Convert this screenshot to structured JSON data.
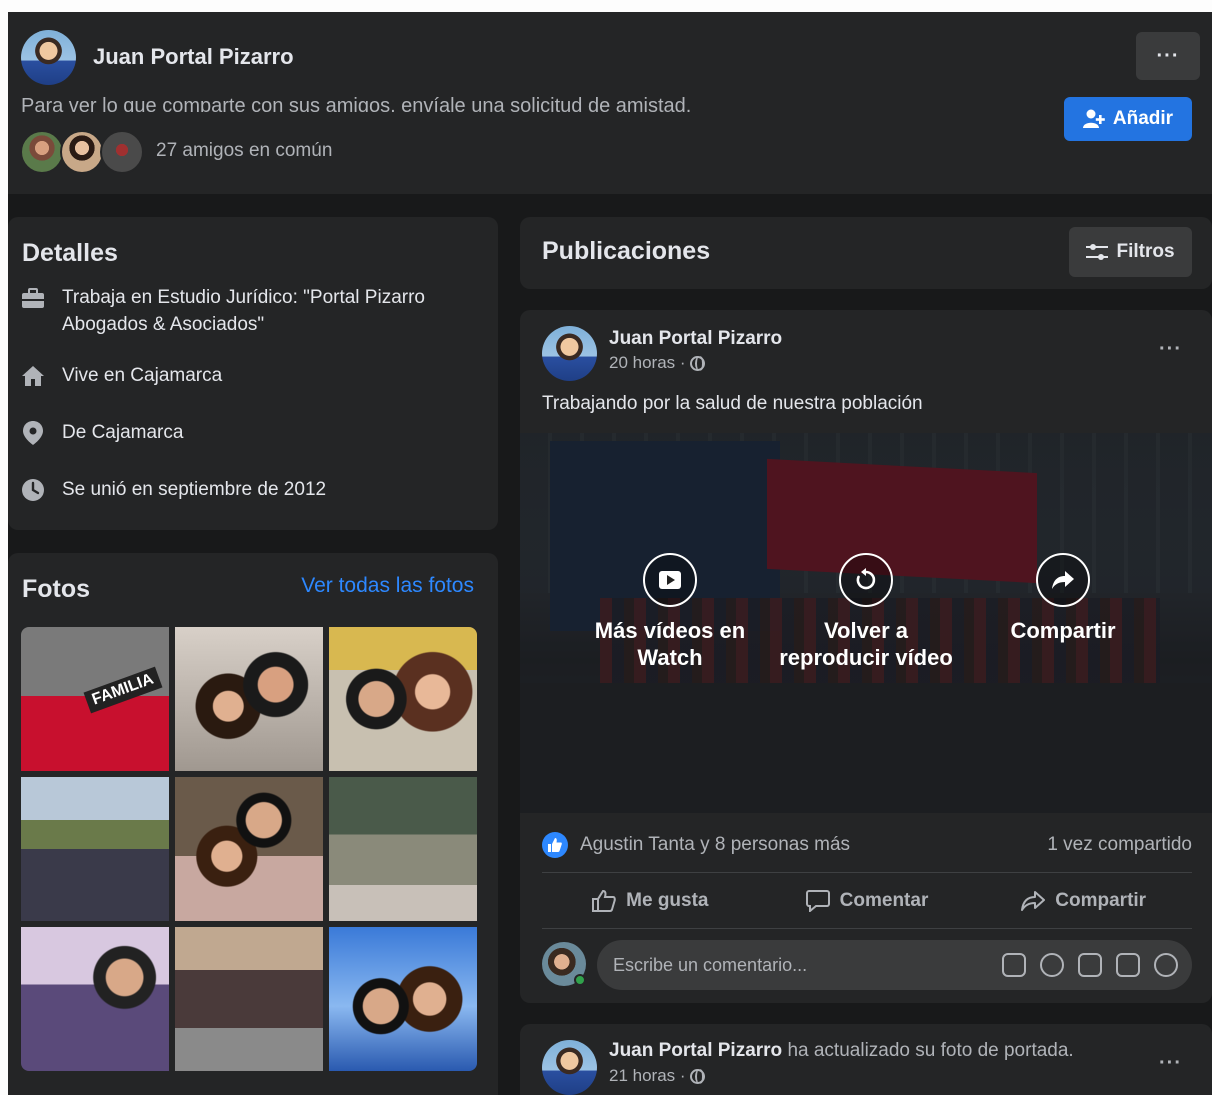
{
  "header": {
    "name": "Juan Portal Pizarro",
    "more": "···",
    "cut_text": "Para ver lo que comparte con sus amigos, envíale una solicitud de amistad.",
    "add_label": "Añadir",
    "mutual_friends": "27 amigos en común"
  },
  "details": {
    "title": "Detalles",
    "items": [
      {
        "icon": "briefcase-icon",
        "text": "Trabaja en Estudio Jurídico: \"Portal Pizarro Abogados & Asociados\""
      },
      {
        "icon": "home-icon",
        "text": "Vive en Cajamarca"
      },
      {
        "icon": "location-pin-icon",
        "text": "De Cajamarca"
      },
      {
        "icon": "clock-icon",
        "text": "Se unió en septiembre de 2012"
      }
    ]
  },
  "photos": {
    "title": "Fotos",
    "see_all": "Ver todas las fotos"
  },
  "publications": {
    "title": "Publicaciones",
    "filters_label": "Filtros"
  },
  "post": {
    "author": "Juan Portal Pizarro",
    "time": "20 horas ·",
    "more": "···",
    "text": "Trabajando por la salud de nuestra población",
    "video_actions": [
      {
        "icon": "play-video-icon",
        "label": "Más vídeos en Watch"
      },
      {
        "icon": "replay-icon",
        "label": "Volver a reproducir vídeo"
      },
      {
        "icon": "share-arrow-icon",
        "label": "Compartir"
      }
    ],
    "reactions_text": "Agustin Tanta y 8 personas más",
    "shares_text": "1 vez compartido",
    "actions": {
      "like": "Me gusta",
      "comment": "Comentar",
      "share": "Compartir"
    },
    "comment_placeholder": "Escribe un comentario..."
  },
  "post2": {
    "author": "Juan Portal Pizarro",
    "action_text": " ha actualizado su foto de portada.",
    "time": "21 horas ·",
    "more": "···"
  },
  "colors": {
    "background": "#18191a",
    "card": "#242526",
    "accent": "#2374e1",
    "link": "#2d88ff"
  }
}
